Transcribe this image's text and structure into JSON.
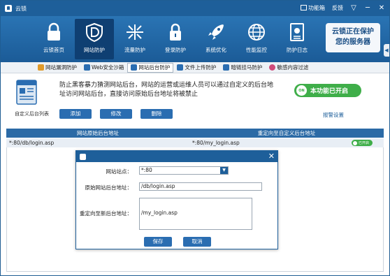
{
  "titlebar": {
    "app_title": "云锁",
    "toolbox": "功能箱",
    "feedback": "反馈",
    "minimize": "─",
    "close": "✕",
    "menu": "▽"
  },
  "nav": {
    "items": [
      {
        "label": "云锁首页",
        "icon": "lock-icon"
      },
      {
        "label": "网站防护",
        "icon": "shield-d-icon"
      },
      {
        "label": "流量防护",
        "icon": "traffic-icon"
      },
      {
        "label": "登录防护",
        "icon": "padlock-icon"
      },
      {
        "label": "系统优化",
        "icon": "rocket-icon"
      },
      {
        "label": "性能监控",
        "icon": "globe-icon"
      },
      {
        "label": "防护日志",
        "icon": "log-icon"
      }
    ],
    "promo_line1": "云锁正在保护",
    "promo_line2": "您的服务器",
    "side_arrow": "◀"
  },
  "subnav": {
    "tabs": [
      {
        "label": "网站漏洞防护",
        "color": "#e09a2a"
      },
      {
        "label": "Web安全沙箱",
        "color": "#2a6db1"
      },
      {
        "label": "网站后台防护",
        "color": "#2a6db1"
      },
      {
        "label": "文件上传防护",
        "color": "#2a6db1"
      },
      {
        "label": "暗链挂马防护",
        "color": "#2a6db1"
      },
      {
        "label": "敏感内容过滤",
        "color": "#d04b7a"
      }
    ]
  },
  "info": {
    "caption": "自定义后台列表",
    "description": "防止黑客暴力猜测网站后台，网站的运营或运维人员可以通过自定义的后台地址访问网站后台，直接访问原始后台地址将被禁止",
    "status": "本功能已开启",
    "status_badge": "ON",
    "report": "报警设置",
    "buttons": {
      "add": "添加",
      "modify": "修改",
      "delete": "删除"
    }
  },
  "table": {
    "columns": [
      "网站原始后台地址",
      "重定向至自定义后台地址"
    ],
    "rows": [
      {
        "original": "*:80/db/login.asp",
        "redirect": "*:80/my_login.asp",
        "toggle": "已开启"
      }
    ]
  },
  "dialog": {
    "site_label": "网站站点：",
    "site_value": "*:80",
    "original_label": "原始网站后台地址：",
    "original_value": "/db/login.asp",
    "redirect_label": "重定向至新后台地址：",
    "redirect_value": "/my_login.asp",
    "save": "保存",
    "cancel": "取消",
    "close": "✕"
  },
  "colors": {
    "brand": "#1e5f9a",
    "accent_green": "#3fae49",
    "button_blue": "#2a6db1"
  }
}
